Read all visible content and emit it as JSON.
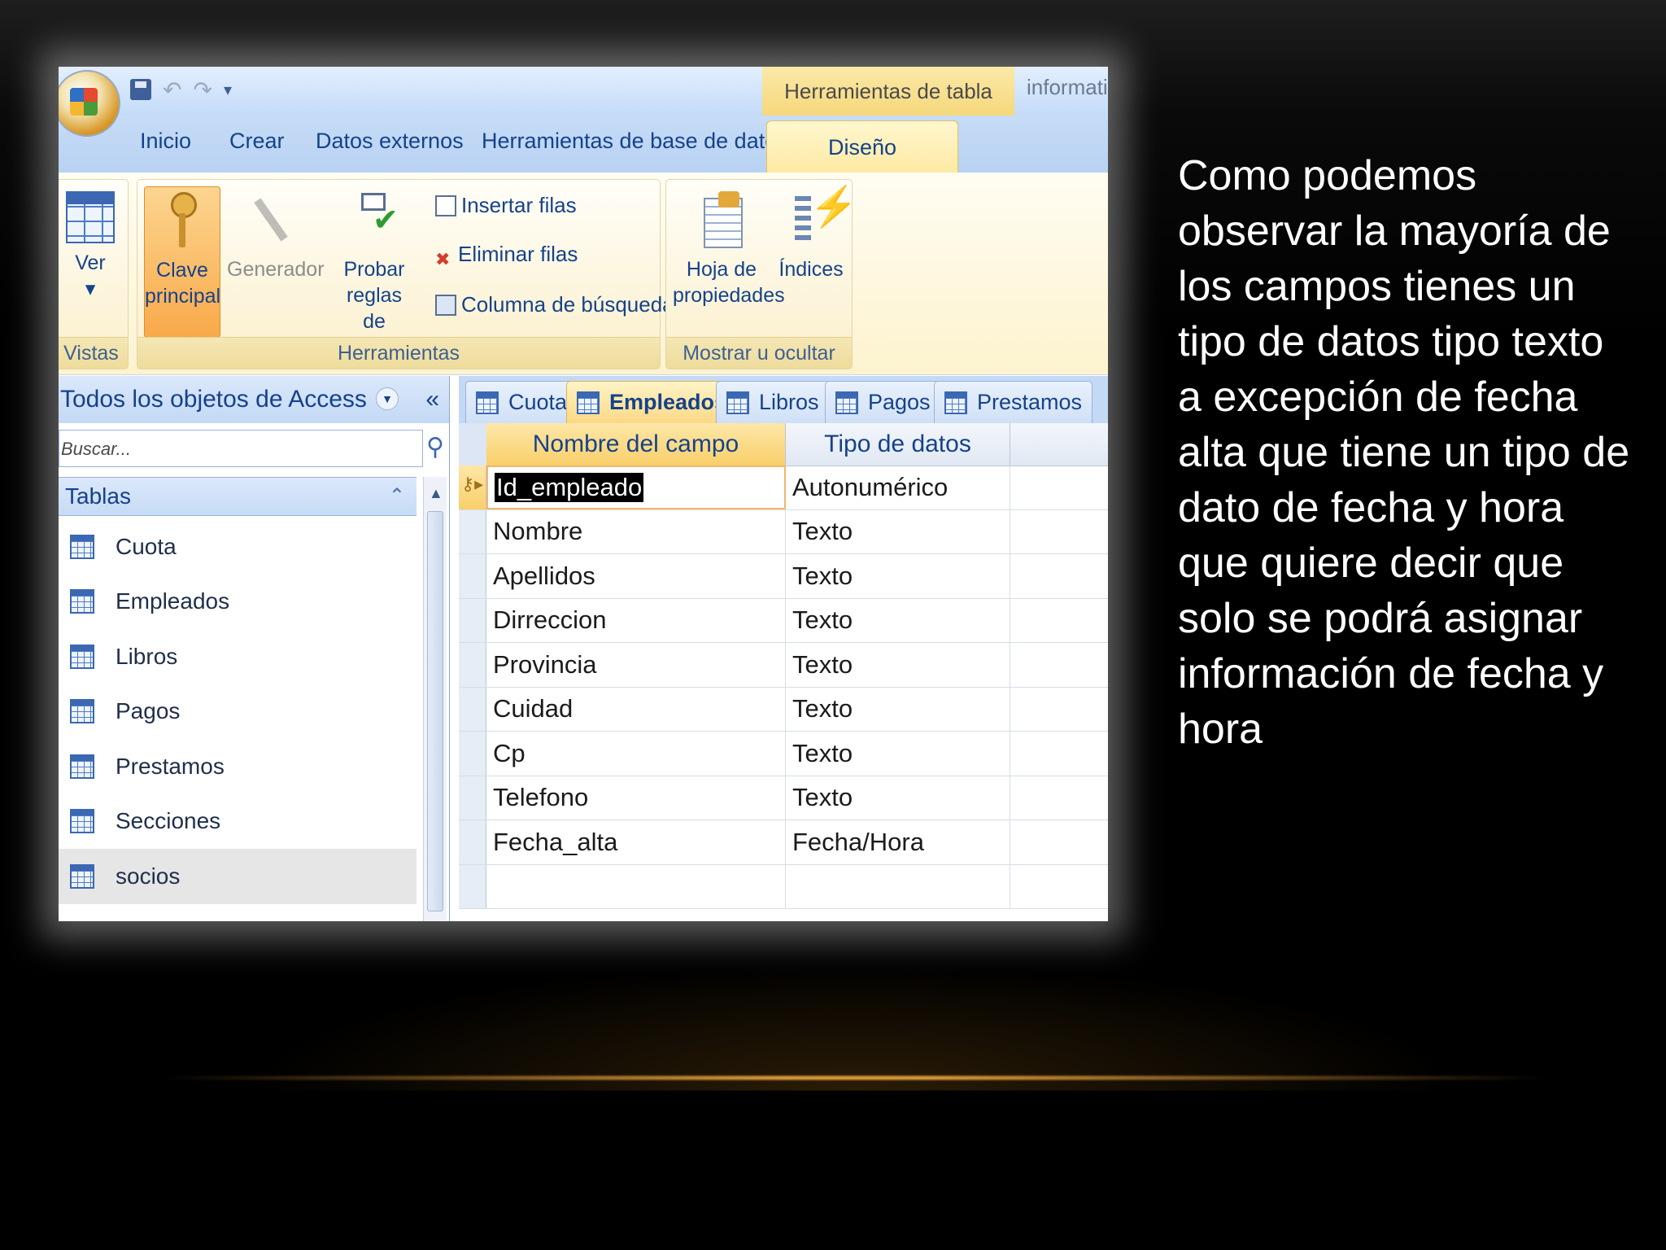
{
  "slide": {
    "body_text": "Como podemos observar la mayoría de los campos tienes un tipo de datos tipo texto a excepción de fecha alta que tiene un tipo de dato de fecha y hora que quiere decir que solo se podrá asignar información de fecha y hora"
  },
  "window": {
    "contextual_group": "Herramientas de tabla",
    "app_title": "informatica acc",
    "quick_access": [
      "save-icon",
      "undo-icon",
      "redo-icon",
      "customize-dropdown"
    ]
  },
  "ribbon_tabs": [
    {
      "label": "Inicio"
    },
    {
      "label": "Crear"
    },
    {
      "label": "Datos externos"
    },
    {
      "label": "Herramientas de base de datos"
    },
    {
      "label": "Diseño",
      "active": true
    }
  ],
  "ribbon": {
    "vistas": {
      "label": "Vistas",
      "ver": "Ver",
      "ver_arrow": "▾"
    },
    "herramientas": {
      "label": "Herramientas",
      "clave_principal_1": "Clave",
      "clave_principal_2": "principal",
      "generador": "Generador",
      "probar_reglas_1": "Probar reglas",
      "probar_reglas_2": "de validación",
      "insertar_filas": "Insertar filas",
      "eliminar_filas": "Eliminar filas",
      "columna_busqueda": "Columna de búsqueda"
    },
    "mostrar": {
      "label": "Mostrar u ocultar",
      "hoja_1": "Hoja de",
      "hoja_2": "propiedades",
      "indices": "Índices"
    }
  },
  "nav_pane": {
    "header": "Todos los objetos de Access",
    "search_placeholder": "Buscar...",
    "group": "Tablas",
    "items": [
      "Cuota",
      "Empleados",
      "Libros",
      "Pagos",
      "Prestamos",
      "Secciones",
      "socios"
    ]
  },
  "doc_tabs": [
    {
      "label": "Cuota"
    },
    {
      "label": "Empleados",
      "active": true
    },
    {
      "label": "Libros"
    },
    {
      "label": "Pagos"
    },
    {
      "label": "Prestamos"
    }
  ],
  "design_grid": {
    "headers": [
      "Nombre del campo",
      "Tipo de datos"
    ],
    "rows": [
      {
        "field": "Id_empleado",
        "type": "Autonumérico",
        "primary_key": true
      },
      {
        "field": "Nombre",
        "type": "Texto"
      },
      {
        "field": "Apellidos",
        "type": "Texto"
      },
      {
        "field": "Dirreccion",
        "type": "Texto"
      },
      {
        "field": "Provincia",
        "type": "Texto"
      },
      {
        "field": "Cuidad",
        "type": "Texto"
      },
      {
        "field": "Cp",
        "type": "Texto"
      },
      {
        "field": "Telefono",
        "type": "Texto"
      },
      {
        "field": "Fecha_alta",
        "type": "Fecha/Hora"
      },
      {
        "field": "",
        "type": ""
      }
    ]
  },
  "colors": {
    "ribbon_active": "#fde9a2",
    "office_blue": "#15428b",
    "glow": "#e6a03c"
  }
}
